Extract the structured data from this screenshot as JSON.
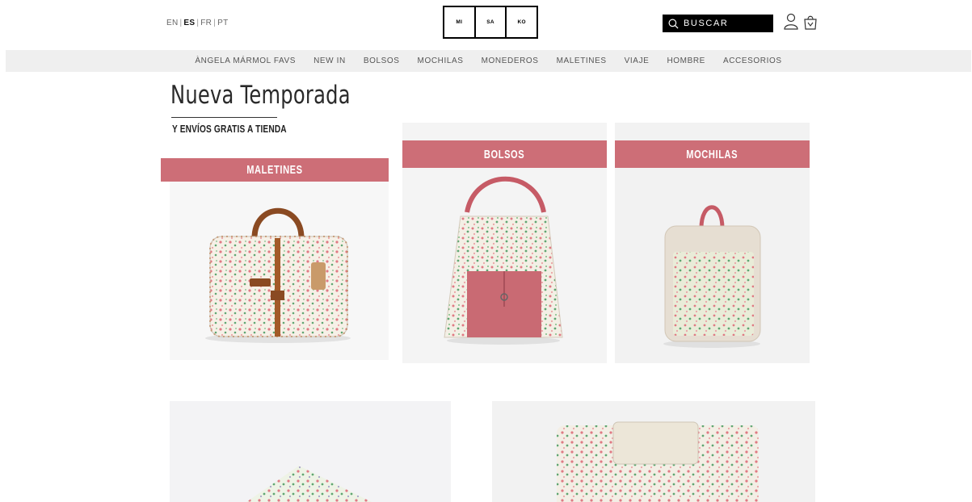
{
  "languages": [
    {
      "code": "EN",
      "active": false
    },
    {
      "code": "ES",
      "active": true
    },
    {
      "code": "FR",
      "active": false
    },
    {
      "code": "PT",
      "active": false
    }
  ],
  "lang_separator": "|",
  "logo": {
    "cells": [
      "MI",
      "SA",
      "KO"
    ]
  },
  "search": {
    "label": "BUSCAR"
  },
  "nav": {
    "items": [
      "ÀNGELA MÁRMOL FAVS",
      "NEW IN",
      "BOLSOS",
      "MOCHILAS",
      "MONEDEROS",
      "MALETINES",
      "VIAJE",
      "HOMBRE",
      "ACCESORIOS"
    ]
  },
  "hero": {
    "title": "Nueva Temporada",
    "subtitle": "Y ENVÍOS GRATIS A TIENDA"
  },
  "categories": {
    "maletines": "MALETINES",
    "bolsos": "BOLSOS",
    "mochilas": "MOCHILAS"
  },
  "colors": {
    "banner": "#cd6e77",
    "nav_bg": "#efefef",
    "accent_black": "#000000"
  },
  "icons": {
    "search": "search-icon",
    "account": "user-icon",
    "cart": "shopping-bag-icon"
  }
}
